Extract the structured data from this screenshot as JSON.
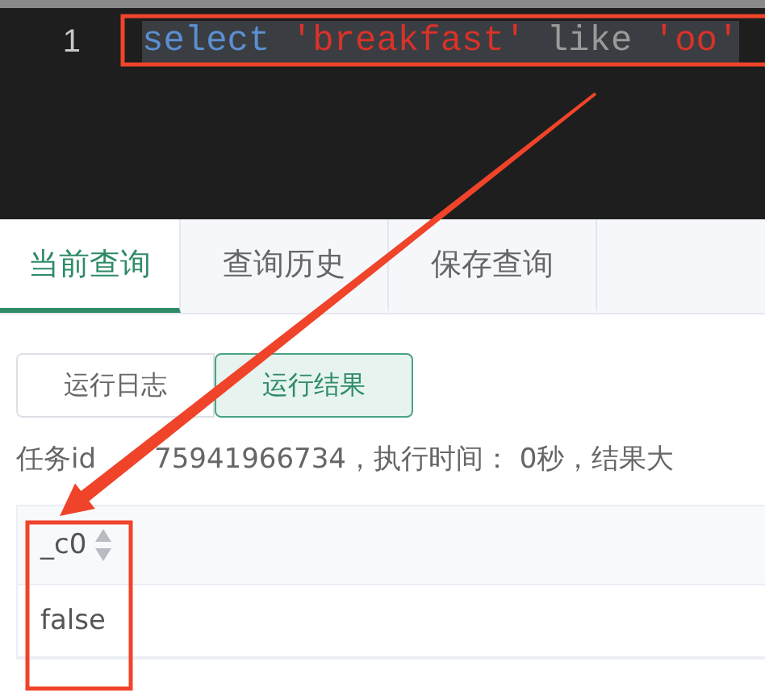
{
  "editor": {
    "lines": [
      {
        "number": "1",
        "selected": true,
        "tokens": [
          {
            "text": "select",
            "kind": "keyword"
          },
          {
            "text": " 'breakfast'",
            "kind": "string"
          },
          {
            "text": " like ",
            "kind": "plain"
          },
          {
            "text": "'oo'",
            "kind": "string"
          }
        ]
      }
    ]
  },
  "tabs": [
    {
      "label": "当前查询",
      "selected": true
    },
    {
      "label": "查询历史",
      "selected": false
    },
    {
      "label": "保存查询",
      "selected": false
    }
  ],
  "views": [
    {
      "label": "运行日志",
      "selected": false
    },
    {
      "label": "运行结果",
      "selected": true
    }
  ],
  "info": {
    "label": "任务id",
    "text": "75941966734，执行时间： 0秒，结果大"
  },
  "table": {
    "columns": [
      {
        "name": "_c0",
        "sortable": true
      }
    ],
    "rows": [
      [
        "false"
      ]
    ]
  }
}
